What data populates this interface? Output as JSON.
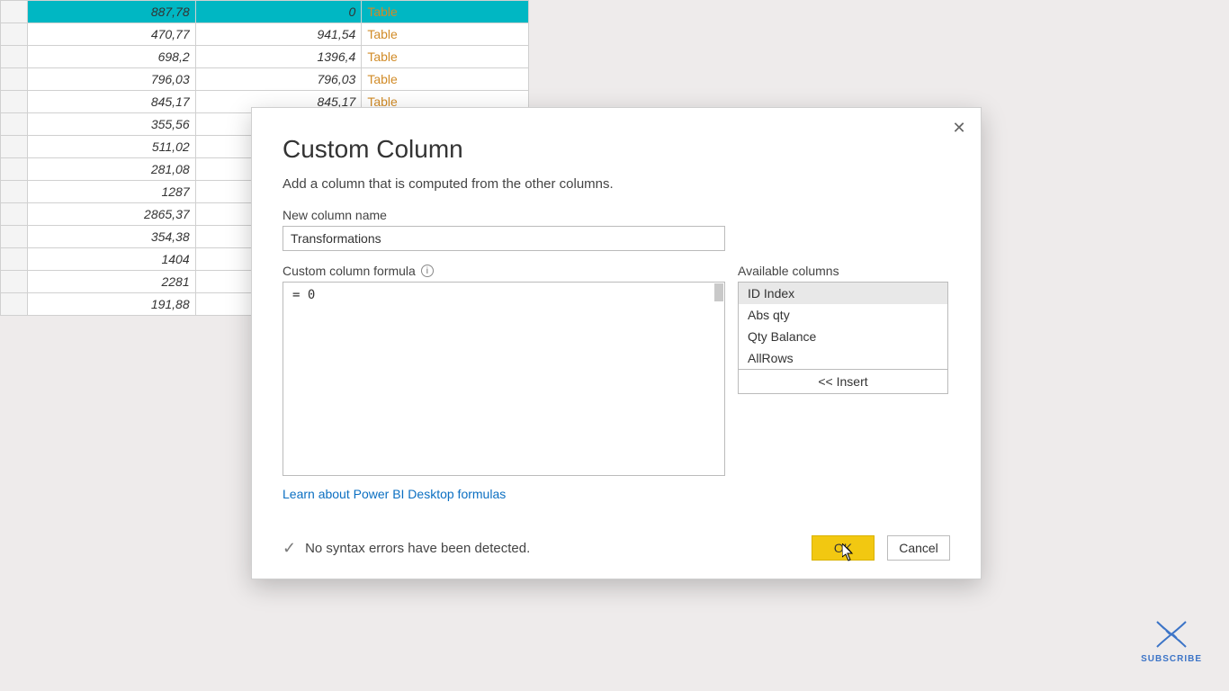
{
  "grid": {
    "link_label": "Table",
    "rows": [
      {
        "b": "887,78",
        "c": "0",
        "d": "Table",
        "sel": true
      },
      {
        "b": "470,77",
        "c": "941,54",
        "d": "Table"
      },
      {
        "b": "698,2",
        "c": "1396,4",
        "d": "Table"
      },
      {
        "b": "796,03",
        "c": "796,03",
        "d": "Table"
      },
      {
        "b": "845,17",
        "c": "845,17",
        "d": "Table"
      },
      {
        "b": "355,56",
        "c": "",
        "d": ""
      },
      {
        "b": "511,02",
        "c": "",
        "d": ""
      },
      {
        "b": "281,08",
        "c": "",
        "d": ""
      },
      {
        "b": "1287",
        "c": "",
        "d": ""
      },
      {
        "b": "2865,37",
        "c": "",
        "d": ""
      },
      {
        "b": "354,38",
        "c": "",
        "d": ""
      },
      {
        "b": "1404",
        "c": "",
        "d": ""
      },
      {
        "b": "2281",
        "c": "",
        "d": ""
      },
      {
        "b": "191,88",
        "c": "",
        "d": ""
      }
    ]
  },
  "dialog": {
    "title": "Custom Column",
    "description": "Add a column that is computed from the other columns.",
    "close_glyph": "✕",
    "name_label": "New column name",
    "name_value": "Transformations",
    "formula_label": "Custom column formula",
    "info_glyph": "i",
    "formula_value": "= 0",
    "available_label": "Available columns",
    "available_columns": [
      "ID Index",
      "Abs qty",
      "Qty Balance",
      "AllRows"
    ],
    "insert_label": "<< Insert",
    "learn_link": "Learn about Power BI Desktop formulas",
    "status_check": "✓",
    "status_text": "No syntax errors have been detected.",
    "ok_label": "OK",
    "cancel_label": "Cancel"
  },
  "subscribe": {
    "label": "SUBSCRIBE"
  }
}
